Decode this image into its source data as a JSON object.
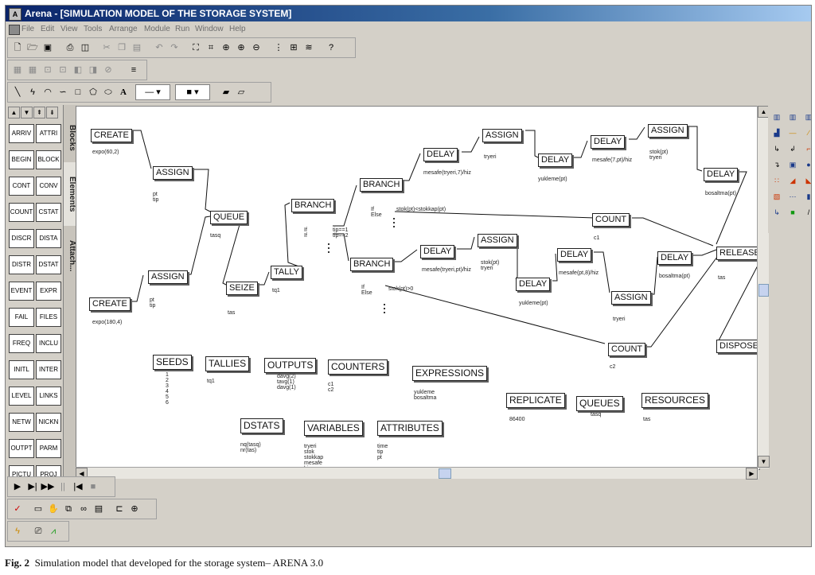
{
  "window": {
    "title": "Arena - [SIMULATION MODEL OF THE STORAGE SYSTEM]"
  },
  "menu": [
    "File",
    "Edit",
    "View",
    "Tools",
    "Arrange",
    "Module",
    "Run",
    "Window",
    "Help"
  ],
  "left_panel": {
    "tabs": [
      "Blocks",
      "Elements",
      "Attach..."
    ],
    "buttons": [
      "ARRIV",
      "ATTRI",
      "BEGIN",
      "BLOCK",
      "CONT",
      "CONV",
      "COUNT",
      "CSTAT",
      "DISCR",
      "DISTA",
      "DISTR",
      "DSTAT",
      "EVENT",
      "EXPR",
      "FAIL",
      "FILES",
      "FREQ",
      "INCLU",
      "INITL",
      "INTER",
      "LEVEL",
      "LINKS",
      "NETW",
      "NICKN",
      "OUTPT",
      "PARM",
      "PICTU",
      "PROJ"
    ]
  },
  "blocks": {
    "create1": {
      "label": "CREATE",
      "note": "expo(60,2)"
    },
    "assign1": {
      "label": "ASSIGN",
      "note": "pt\ntip"
    },
    "create2": {
      "label": "CREATE",
      "note": "expo(180,4)"
    },
    "assign2": {
      "label": "ASSIGN",
      "note": "pt\ntip"
    },
    "queue": {
      "label": "QUEUE",
      "note": "tasq"
    },
    "seize": {
      "label": "SEIZE",
      "note": "tas"
    },
    "tally": {
      "label": "TALLY",
      "note": "tq1"
    },
    "branch1": {
      "label": "BRANCH",
      "note": "If\nIf",
      "cond": "tip==1\ntip==2"
    },
    "branch2": {
      "label": "BRANCH",
      "note": "If\nElse",
      "cond": "stok(pt)<stokkap(pt)"
    },
    "branch3": {
      "label": "BRANCH",
      "note": "If\nElse",
      "cond": "stok(pt)>0"
    },
    "delay1": {
      "label": "DELAY",
      "note": "mesafe(tryeri,7)/hiz"
    },
    "assign3": {
      "label": "ASSIGN",
      "note": "tryeri"
    },
    "delay2": {
      "label": "DELAY",
      "note": "yukleme(pt)"
    },
    "delay3": {
      "label": "DELAY",
      "note": "mesafe(7,pt)/hiz"
    },
    "assign4": {
      "label": "ASSIGN",
      "note": "stok(pt)\ntryeri"
    },
    "delay4": {
      "label": "DELAY",
      "note": "bosaltma(pt)"
    },
    "count1": {
      "label": "COUNT",
      "note": "c1"
    },
    "delay5": {
      "label": "DELAY",
      "note": "mesafe(tryeri,pt)/hiz"
    },
    "assign5": {
      "label": "ASSIGN",
      "note": "stok(pt)\ntryeri"
    },
    "delay6": {
      "label": "DELAY",
      "note": "yukleme(pt)"
    },
    "delay7": {
      "label": "DELAY",
      "note": "mesafe(pt,8)/hiz"
    },
    "assign6": {
      "label": "ASSIGN",
      "note": "tryeri"
    },
    "delay8": {
      "label": "DELAY",
      "note": "bosaltma(pt)"
    },
    "release": {
      "label": "RELEASE",
      "note": "tas"
    },
    "count2": {
      "label": "COUNT",
      "note": "c2"
    },
    "dispose": {
      "label": "DISPOSE"
    }
  },
  "elements": {
    "seeds": {
      "label": "SEEDS",
      "note": "1\n2\n3\n4\n5\n6"
    },
    "tallies": {
      "label": "TALLIES",
      "note": "tq1"
    },
    "outputs": {
      "label": "OUTPUTS",
      "note": "davg(2)\ntavg(1)\ndavg(1)"
    },
    "counters": {
      "label": "COUNTERS",
      "note": "c1\nc2"
    },
    "expressions": {
      "label": "EXPRESSIONS",
      "note": "yukleme\nbosaltma"
    },
    "replicate": {
      "label": "REPLICATE",
      "note": "86400"
    },
    "queues": {
      "label": "QUEUES",
      "note": "tasq"
    },
    "resources": {
      "label": "RESOURCES",
      "note": "tas"
    },
    "dstats": {
      "label": "DSTATS",
      "note": "nq(tasq)\nnr(tas)"
    },
    "variables": {
      "label": "VARIABLES",
      "note": "tryeri\nstok\nstokkap\nmesafe\nhiz"
    },
    "attributes": {
      "label": "ATTRIBUTES",
      "note": "time\ntip\npt"
    }
  },
  "caption": {
    "fig": "Fig. 2",
    "text": "Simulation model that developed for the storage system– ARENA 3.0"
  }
}
